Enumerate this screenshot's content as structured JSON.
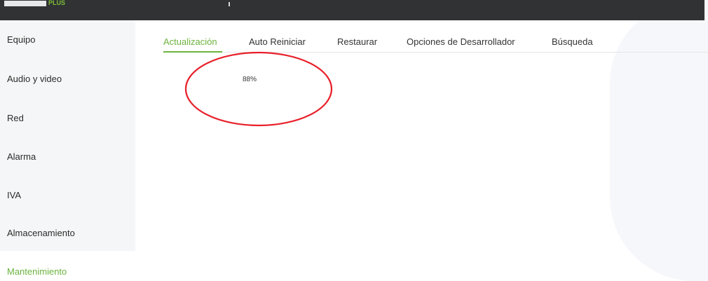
{
  "header": {
    "logo_text": "PLUS",
    "logo_color": "#7fbf3a"
  },
  "sidebar": {
    "items": [
      {
        "label": "Equipo",
        "active": false
      },
      {
        "label": "Audio y video",
        "active": false
      },
      {
        "label": "Red",
        "active": false
      },
      {
        "label": "Alarma",
        "active": false
      },
      {
        "label": "IVA",
        "active": false
      },
      {
        "label": "Almacenamiento",
        "active": false
      },
      {
        "label": "Mantenimiento",
        "active": true
      }
    ]
  },
  "tabs": [
    {
      "label": "Actualización",
      "active": true
    },
    {
      "label": "Auto Reiniciar",
      "active": false
    },
    {
      "label": "Restaurar",
      "active": false
    },
    {
      "label": "Opciones de Desarrollador",
      "active": false
    },
    {
      "label": "Búsqueda",
      "active": false
    }
  ],
  "upgrade": {
    "progress_text": "88%",
    "progress_percent": 88
  },
  "colors": {
    "accent": "#6db33f",
    "annotation": "#e8212b",
    "topbar": "#303233",
    "sidebar_bg": "#f5f6f7"
  }
}
